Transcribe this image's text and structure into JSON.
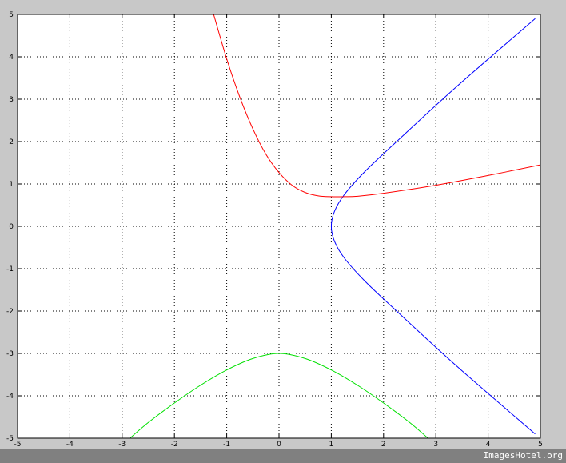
{
  "chart_data": {
    "type": "line",
    "title": "",
    "xlabel": "",
    "ylabel": "",
    "xlim": [
      -5,
      5
    ],
    "ylim": [
      -5,
      5
    ],
    "xticks": [
      -5,
      -4,
      -3,
      -2,
      -1,
      0,
      1,
      2,
      3,
      4,
      5
    ],
    "yticks": [
      -5,
      -4,
      -3,
      -2,
      -1,
      0,
      1,
      2,
      3,
      4,
      5
    ],
    "grid": true,
    "legend": "none",
    "series": [
      {
        "color": "#0000ff",
        "x": [
          4.9,
          3.4,
          2.25,
          1.64,
          1.25,
          1.06,
          1.0,
          1.06,
          1.25,
          1.64,
          2.25,
          3.4,
          4.9
        ],
        "y": [
          -4.9,
          -3.3,
          -2.0,
          -1.29,
          -0.75,
          -0.35,
          0.0,
          0.35,
          0.75,
          1.29,
          2.0,
          3.3,
          4.9
        ]
      },
      {
        "color": "#ff0000",
        "x": [
          -1.25,
          -1.0,
          -0.75,
          -0.5,
          -0.25,
          0.0,
          0.25,
          0.5,
          0.75,
          1.0,
          1.25,
          1.5,
          2.0,
          3.0,
          4.0,
          5.0
        ],
        "y": [
          5.0,
          3.95,
          3.05,
          2.3,
          1.7,
          1.27,
          0.97,
          0.8,
          0.72,
          0.7,
          0.7,
          0.71,
          0.78,
          0.97,
          1.2,
          1.45
        ]
      },
      {
        "color": "#00e000",
        "x": [
          -2.85,
          -2.5,
          -2.0,
          -1.5,
          -1.0,
          -0.5,
          0.0,
          0.5,
          1.0,
          1.5,
          2.0,
          2.5,
          2.85
        ],
        "y": [
          -5.0,
          -4.63,
          -4.17,
          -3.75,
          -3.39,
          -3.12,
          -3.0,
          -3.12,
          -3.39,
          -3.75,
          -4.17,
          -4.63,
          -5.0
        ]
      }
    ]
  },
  "watermark": "ImagesHotel.org"
}
